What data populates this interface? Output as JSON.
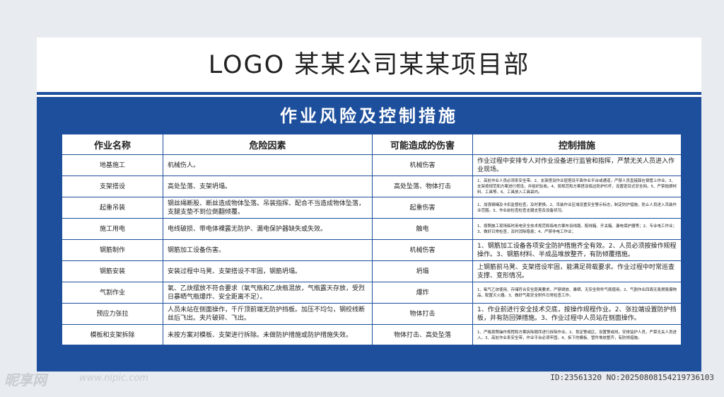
{
  "header": {
    "logo_title": "LOGO 某某公司某某项目部"
  },
  "panel": {
    "title": "作业风险及控制措施"
  },
  "table": {
    "columns": [
      "作业名称",
      "危险因素",
      "可能造成的伤害",
      "控制措施"
    ],
    "rows": [
      {
        "name": "地基施工",
        "hazard": "机械伤人。",
        "injury": "机械伤害",
        "measure": "作业过程中安排专人对作业设备进行监管和指挥，严禁无关人员进入作业现场。"
      },
      {
        "name": "支架搭设",
        "hazard": "高处坠落、支架坍塌。",
        "injury": "高处坠落、物体打击",
        "measure": "1、高处作业人员必须系安全带。2、支架搭设作业层搭设平面作业平台或通道，严禁人员直接踩在钢管上作业。3、支架按规范和方案进行搭设，并组织验收。4、按规范和方案搭设临边防护栏杆，设置密目式安全网。5、严禁抛掷材料、工具等。6、工具放入工具袋内。"
      },
      {
        "name": "起重吊装",
        "hazard": "钢丝绳断股、断丝造成物体坠落。吊装指挥、配合不当造成物体坠落，支腿支垫不到位倒翻倾覆。",
        "injury": "起重伤害",
        "measure": "1、加强钢绳及卡扣监督检查，及时更换。2、吊装作业区域设置安全警示标志，制定防护措施，防止人员进入吊装作业范围。3、作业前检查检查支腿支垫及设备状况。"
      },
      {
        "name": "施工用电",
        "hazard": "电线破损、带电体裸露无防护、漏电保护器缺失或失效。",
        "injury": "触电",
        "measure": "1、按照施工现场临时用电安全技术规范和临电方案布设线路、配线箱、开关箱、漏电保护器等；2、专业电工作业；3、做好日常检查，及时消除隐患；4、严禁非电工作业；"
      },
      {
        "name": "钢筋制作",
        "hazard": "钢筋加工设备伤害。",
        "injury": "机械伤害",
        "measure": "1、钢筋加工设备各项安全防护措施齐全有效。2、人员必须按操作规程操作。3、钢筋材料、半成品堆放整齐，有防倾覆措施。"
      },
      {
        "name": "钢筋安装",
        "hazard": "安装过程中马凳、支架搭设不牢固，钢筋坍塌。",
        "injury": "坍塌",
        "measure": "上钢筋前马凳、支架搭设牢固，能满足荷载要求。作业过程中时常巡查支撑、变形情况。"
      },
      {
        "name": "气割作业",
        "hazard": "氧、乙炔摆放不符合要求（氧气瓶和乙炔瓶混放，气瓶露天存放，受烈日暴晒气瓶爆炸、安全距离不足）。",
        "injury": "爆炸",
        "measure": "1、氧气乙炔使用、存储符合安全距离要求，严禁倒放、暴晒、无安全附件气瓶使用。2、气割作业四周无易燃易爆物品，配置灭火器。3、做好气瓶安全附件日常检查工作。"
      },
      {
        "name": "预应力张拉",
        "hazard": "人员未站在侧面操作，千斤顶前端无防护挡板。加压不均匀，钢绞线断丝后飞出。夹片破碎、飞出。",
        "injury": "物体打击",
        "measure": "1、作业前进行安全技术交底，按操作规程作业。2、张拉端设置防护挡板，并有防回弹措施。3、作业过程中人员站在侧面操作。"
      },
      {
        "name": "模板和支架拆除",
        "hazard": "未按方案对模板、支架进行拆除。未做防护措施或防护措施失效。",
        "injury": "物体打击、高处坠落",
        "measure": "1、严格按照操作规程和方案拆除顺序进行拆除作业。2、划定警戒区，设置警戒线，安排监护人员，严禁无关人员进入。3、高处作业系安全带，作业平台必须牢固。4、拆下的模板、管件堆放整齐，有防倾措施。"
      }
    ]
  },
  "watermark": {
    "brand": "昵享网",
    "url": "www.nipic.com",
    "id_text": "ID:23561320 NO:20250808154219736103"
  },
  "colors": {
    "primary_blue": "#1d4f9c",
    "background": "#e8ebef",
    "text": "#222222"
  }
}
